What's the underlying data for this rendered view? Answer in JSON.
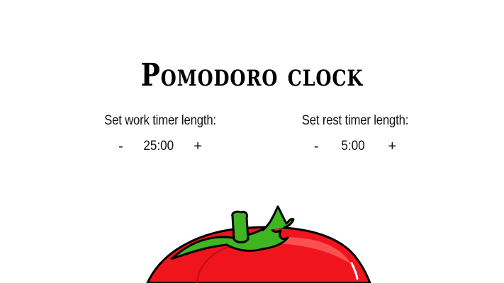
{
  "header": {
    "title": "Pomodoro clock"
  },
  "work_timer": {
    "label": "Set work timer length:",
    "decrement": "-",
    "value": "25:00",
    "increment": "+"
  },
  "rest_timer": {
    "label": "Set rest timer length:",
    "decrement": "-",
    "value": "5:00",
    "increment": "+"
  },
  "colors": {
    "tomato_red": "#f0141c",
    "tomato_highlight": "#ff5a5a",
    "stem_green": "#3fb521",
    "outline": "#000000"
  },
  "icons": {
    "tomato": "tomato-clock-icon"
  }
}
